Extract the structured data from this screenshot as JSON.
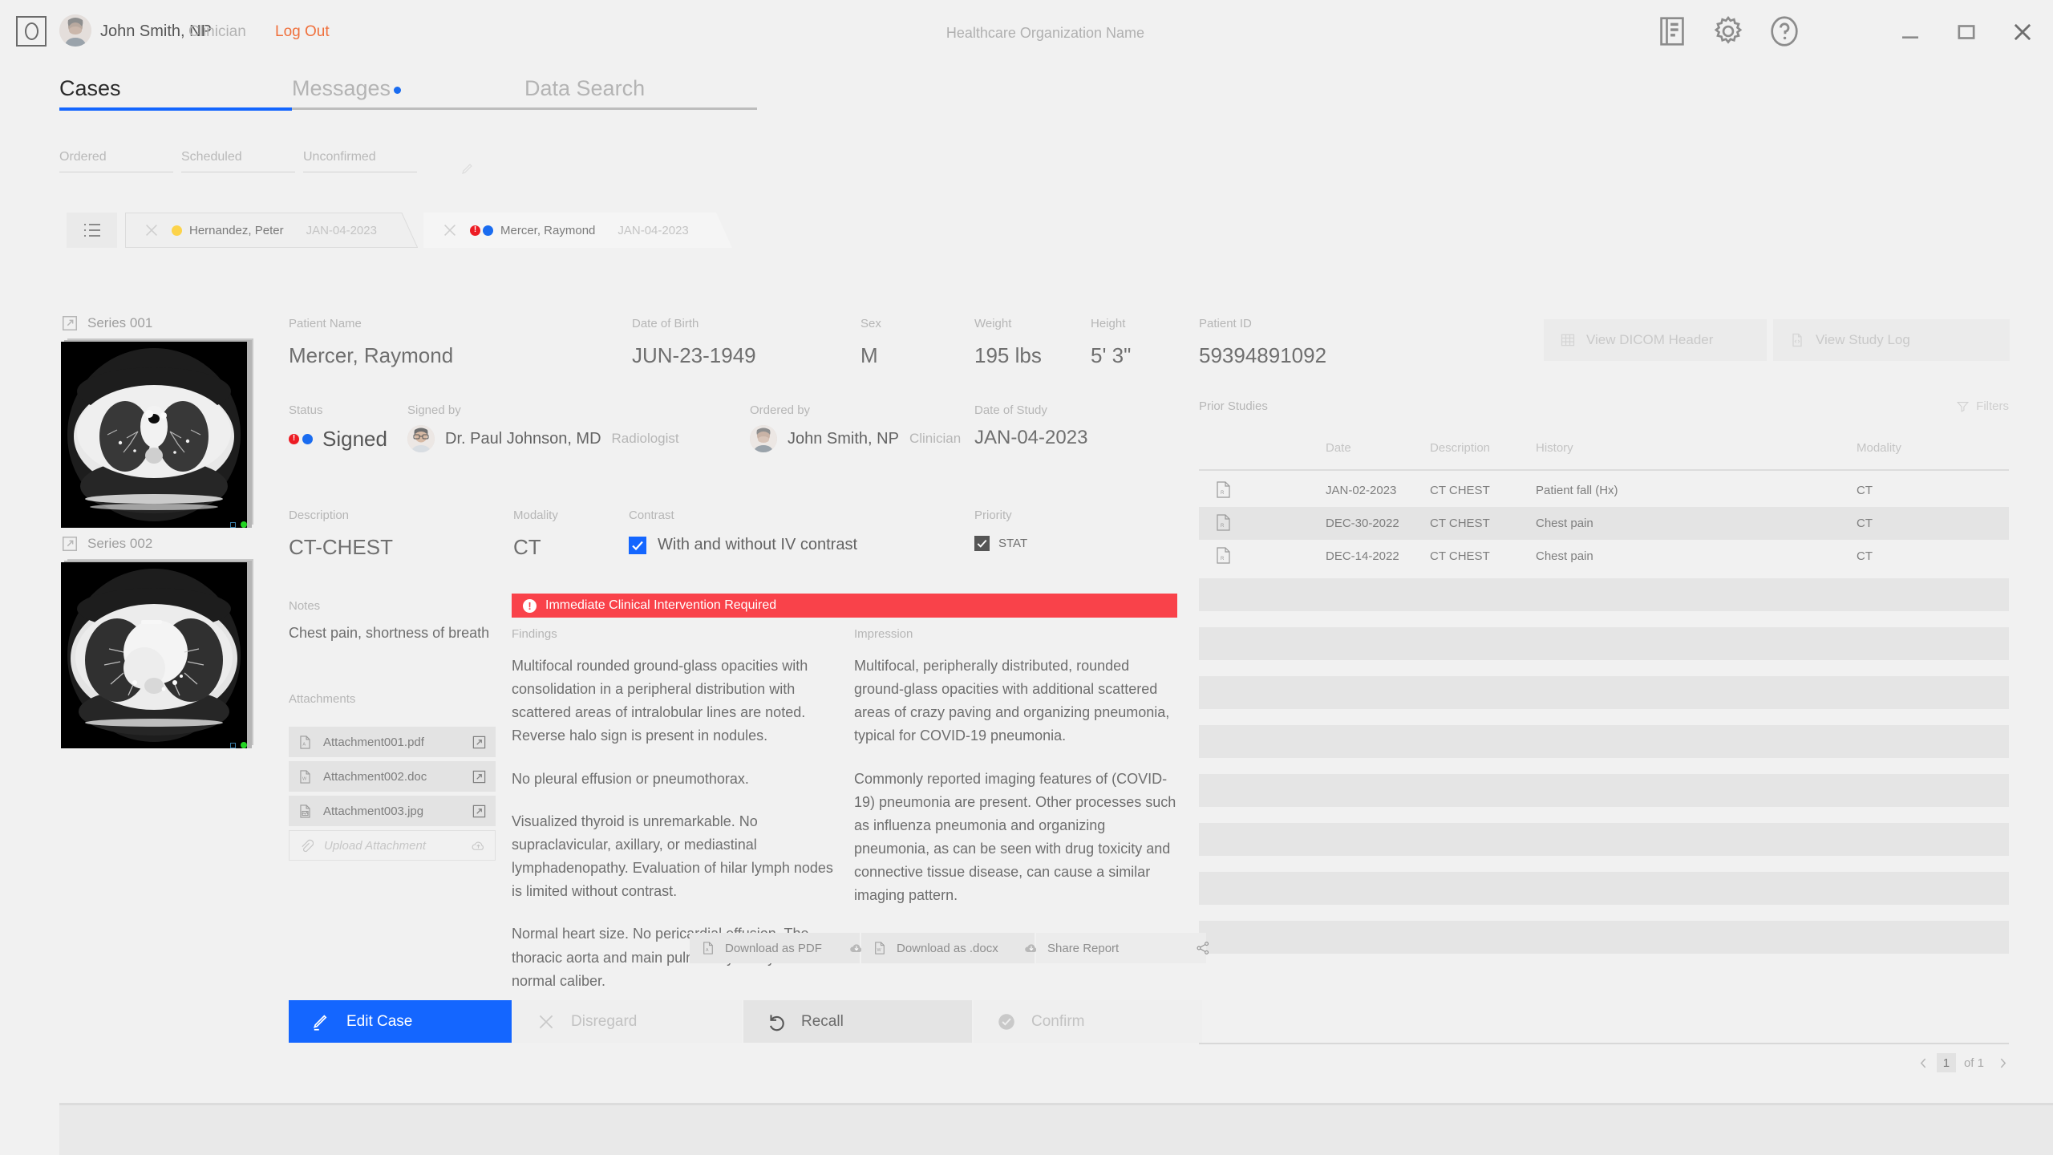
{
  "topbar": {
    "logo_icon": "app-logo-icon",
    "user_name": "John Smith, NP",
    "user_role": "Clinician",
    "logout_label": "Log Out",
    "org_name": "Healthcare Organization Name",
    "icons": [
      "book-icon",
      "gear-icon",
      "help-icon"
    ],
    "window_controls": [
      "minimize-icon",
      "maximize-icon",
      "close-icon"
    ]
  },
  "main_tabs": [
    {
      "label": "Cases",
      "active": true,
      "badge": false
    },
    {
      "label": "Messages",
      "active": false,
      "badge": true
    },
    {
      "label": "Data Search",
      "active": false,
      "badge": false
    }
  ],
  "sub_tabs": [
    {
      "label": "Ordered"
    },
    {
      "label": "Scheduled"
    },
    {
      "label": "Unconfirmed"
    }
  ],
  "case_tabs": [
    {
      "name": "Hernandez, Peter",
      "date": "JAN-04-2023",
      "active": false,
      "dots": [
        "#fcd34a"
      ]
    },
    {
      "name": "Mercer, Raymond",
      "date": "JAN-04-2023",
      "active": true,
      "dots": [
        "alert",
        "#1a6cf0"
      ]
    }
  ],
  "series": [
    {
      "label": "Series 001"
    },
    {
      "label": "Series 002"
    }
  ],
  "patient": {
    "name_label": "Patient Name",
    "name_value": "Mercer, Raymond",
    "dob_label": "Date of Birth",
    "dob_value": "JUN-23-1949",
    "sex_label": "Sex",
    "sex_value": "M",
    "weight_label": "Weight",
    "weight_value": "195 lbs",
    "height_label": "Height",
    "height_value": "5' 3\"",
    "id_label": "Patient ID",
    "id_value": "59394891092"
  },
  "header_actions": [
    {
      "label": "View DICOM Header",
      "icon": "table-icon"
    },
    {
      "label": "View Study Log",
      "icon": "code-file-icon"
    }
  ],
  "study": {
    "status_label": "Status",
    "status_value": "Signed",
    "status_dots": [
      "#ed1c24",
      "#1a6cf0"
    ],
    "signed_by_label": "Signed by",
    "signed_by_name": "Dr. Paul Johnson, MD",
    "signed_by_role": "Radiologist",
    "ordered_by_label": "Ordered by",
    "ordered_by_name": "John Smith, NP",
    "ordered_by_role": "Clinician",
    "date_of_study_label": "Date of Study",
    "date_of_study_value": "JAN-04-2023",
    "description_label": "Description",
    "description_value": "CT-CHEST",
    "modality_label": "Modality",
    "modality_value": "CT",
    "contrast_label": "Contrast",
    "contrast_option": "With and without IV contrast",
    "contrast_checked": true,
    "priority_label": "Priority",
    "priority_option": "STAT",
    "priority_checked": true
  },
  "alert": {
    "text": "Immediate Clinical Intervention Required",
    "color": "#f9424a"
  },
  "report": {
    "findings_label": "Findings",
    "findings": [
      "Multifocal rounded ground-glass opacities with consolidation in a peripheral distribution with scattered areas of intralobular lines are noted. Reverse halo sign is present in nodules.",
      "No pleural effusion or pneumothorax.",
      "Visualized thyroid is unremarkable. No supraclavicular, axillary, or mediastinal lymphadenopathy. Evaluation of hilar lymph nodes is limited without contrast.",
      "Normal heart size. No pericardial effusion. The thoracic aorta and main pulmonary artery are normal caliber."
    ],
    "impression_label": "Impression",
    "impression": [
      "Multifocal, peripherally distributed, rounded ground-glass opacities with additional  scattered  areas of crazy paving and organizing pneumonia, typical for COVID-19 pneumonia.",
      "Commonly reported imaging features of (COVID-19) pneumonia are present.  Other processes such as influenza pneumonia and organizing pneumonia, as can be seen with drug toxicity and connective tissue disease, can cause a similar imaging pattern."
    ]
  },
  "notes": {
    "label": "Notes",
    "value": "Chest pain, shortness of breath"
  },
  "attachments": {
    "label": "Attachments",
    "items": [
      {
        "name": "Attachment001.pdf",
        "icon": "pdf-file-icon"
      },
      {
        "name": "Attachment002.doc",
        "icon": "word-file-icon"
      },
      {
        "name": "Attachment003.jpg",
        "icon": "image-file-icon"
      }
    ],
    "upload_placeholder": "Upload Attachment"
  },
  "prior_studies": {
    "title": "Prior Studies",
    "filters_label": "Filters",
    "columns": [
      "Date",
      "Description",
      "History",
      "Modality"
    ],
    "rows": [
      {
        "date": "JAN-02-2023",
        "description": "CT CHEST",
        "history": "Patient fall (Hx)",
        "modality": "CT"
      },
      {
        "date": "DEC-30-2022",
        "description": "CT CHEST",
        "history": "Chest pain",
        "modality": "CT"
      },
      {
        "date": "DEC-14-2022",
        "description": "CT CHEST",
        "history": "Chest pain",
        "modality": "CT"
      }
    ],
    "empty_row_count": 8
  },
  "pager": {
    "current": "1",
    "of_label": "of 1"
  },
  "download_bar": [
    {
      "label": "Download as PDF",
      "file_icon": "pdf-file-icon",
      "tail_icon": "cloud-download-icon"
    },
    {
      "label": "Download as .docx",
      "file_icon": "word-file-icon",
      "tail_icon": "cloud-download-icon"
    },
    {
      "label": "Share Report",
      "file_icon": "",
      "tail_icon": "share-icon"
    }
  ],
  "actions": [
    {
      "label": "Edit Case",
      "icon": "pencil-icon",
      "state": "primary"
    },
    {
      "label": "Disregard",
      "icon": "x-icon",
      "state": "disabled"
    },
    {
      "label": "Recall",
      "icon": "undo-icon",
      "state": "enabled"
    },
    {
      "label": "Confirm",
      "icon": "check-circle-icon",
      "state": "disabled"
    }
  ],
  "colors": {
    "accent": "#1466ff",
    "alert": "#f9424a",
    "logout": "#f0703c",
    "background": "#f1f1f1"
  }
}
